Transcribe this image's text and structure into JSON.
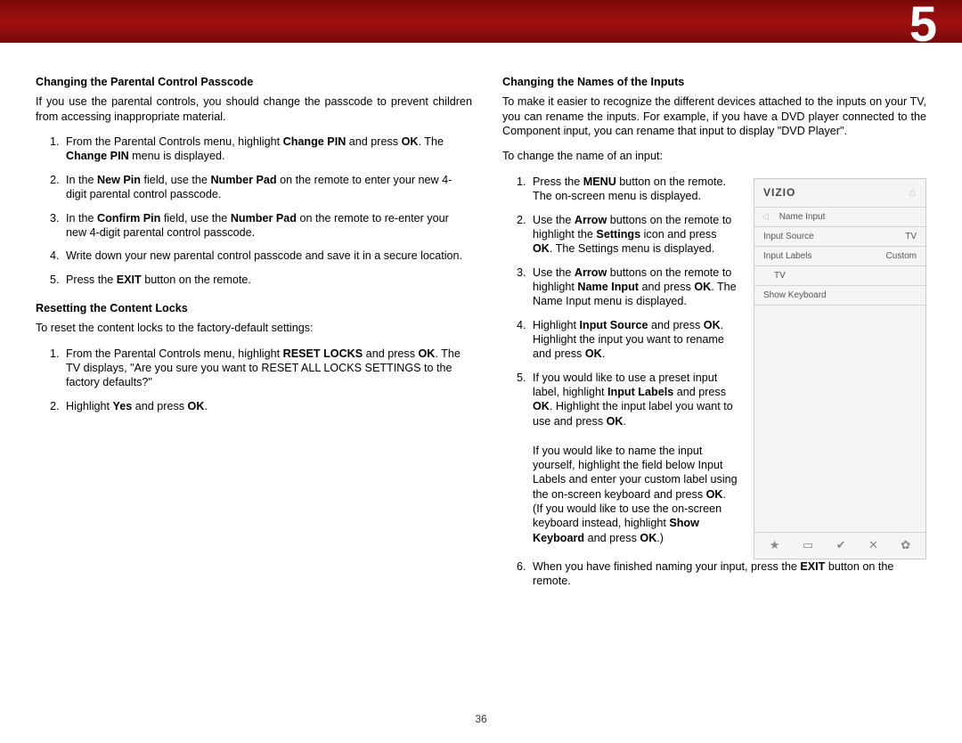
{
  "chapter_number": "5",
  "page_number": "36",
  "left": {
    "section1_title": "Changing the Parental Control Passcode",
    "section1_intro": "If you use the parental controls, you should change the passcode to prevent children from accessing inappropriate material.",
    "s1_step1_a": "From the Parental Controls menu, highlight ",
    "s1_step1_b": "Change PIN",
    "s1_step1_c": " and press ",
    "s1_step1_d": "OK",
    "s1_step1_e": ". The ",
    "s1_step1_f": "Change PIN",
    "s1_step1_g": " menu is displayed.",
    "s1_step2_a": "In the ",
    "s1_step2_b": "New Pin",
    "s1_step2_c": " field, use the ",
    "s1_step2_d": "Number Pad",
    "s1_step2_e": " on the remote to enter your new 4-digit parental control passcode.",
    "s1_step3_a": "In the ",
    "s1_step3_b": "Confirm Pin",
    "s1_step3_c": " field, use the ",
    "s1_step3_d": "Number Pad",
    "s1_step3_e": " on the remote to re-enter your new 4-digit parental control passcode.",
    "s1_step4": "Write down your new parental control passcode and save it in a secure location.",
    "s1_step5_a": "Press the ",
    "s1_step5_b": "EXIT",
    "s1_step5_c": " button on the remote.",
    "section2_title": "Resetting the Content Locks",
    "section2_intro": "To reset the content locks to the factory-default settings:",
    "s2_step1_a": "From the Parental Controls menu, highlight ",
    "s2_step1_b": "RESET LOCKS",
    "s2_step1_c": " and press ",
    "s2_step1_d": "OK",
    "s2_step1_e": ". The TV displays, \"Are you sure you want to RESET ALL LOCKS SETTINGS to the factory defaults?\"",
    "s2_step2_a": "Highlight ",
    "s2_step2_b": "Yes",
    "s2_step2_c": " and press ",
    "s2_step2_d": "OK",
    "s2_step2_e": "."
  },
  "right": {
    "section_title": "Changing the Names of the Inputs",
    "intro": "To make it easier to recognize the different devices attached to the inputs on your TV, you can rename the inputs. For example, if you have a DVD player connected to the Component input, you can rename that input to display \"DVD Player\".",
    "lead": "To change the name of an input:",
    "step1_a": "Press the ",
    "step1_b": "MENU",
    "step1_c": " button on the remote. The on-screen menu is displayed.",
    "step2_a": "Use the ",
    "step2_b": "Arrow",
    "step2_c": " buttons on the remote to highlight the ",
    "step2_d": "Settings",
    "step2_e": " icon and press ",
    "step2_f": "OK",
    "step2_g": ". The Settings menu is displayed.",
    "step3_a": "Use the ",
    "step3_b": "Arrow",
    "step3_c": " buttons on the remote to highlight ",
    "step3_d": "Name Input",
    "step3_e": " and press ",
    "step3_f": "OK",
    "step3_g": ". The Name Input menu is displayed.",
    "step4_a": "Highlight ",
    "step4_b": "Input Source",
    "step4_c": " and press ",
    "step4_d": "OK",
    "step4_e": ". Highlight the input you want to rename and press ",
    "step4_f": "OK",
    "step4_g": ".",
    "step5_a": "If you would like to use a preset input label, highlight ",
    "step5_b": "Input Labels",
    "step5_c": " and press ",
    "step5_d": "OK",
    "step5_e": ". Highlight the input label you want to use and press ",
    "step5_f": "OK",
    "step5_g": ".",
    "step5_para2_a": "If you would like to name the input yourself, highlight the field below Input Labels and enter your custom label using the on-screen keyboard and press ",
    "step5_para2_b": "OK",
    "step5_para2_c": ". (If you would like to use the on-screen keyboard instead, highlight ",
    "step5_para2_d": "Show Keyboard",
    "step5_para2_e": " and press ",
    "step5_para2_f": "OK",
    "step5_para2_g": ".)",
    "step6_a": "When you have finished naming your input, press the ",
    "step6_b": "EXIT",
    "step6_c": " button on the remote."
  },
  "tv_menu": {
    "brand": "VIZIO",
    "breadcrumb": "Name Input",
    "row1_label": "Input Source",
    "row1_value": "TV",
    "row2_label": "Input Labels",
    "row2_value": "Custom",
    "row3_label": "TV",
    "row4_label": "Show Keyboard",
    "footer_star": "★",
    "footer_pip": "▭",
    "footer_v": "✔",
    "footer_x": "✕",
    "footer_gear": "✿"
  }
}
